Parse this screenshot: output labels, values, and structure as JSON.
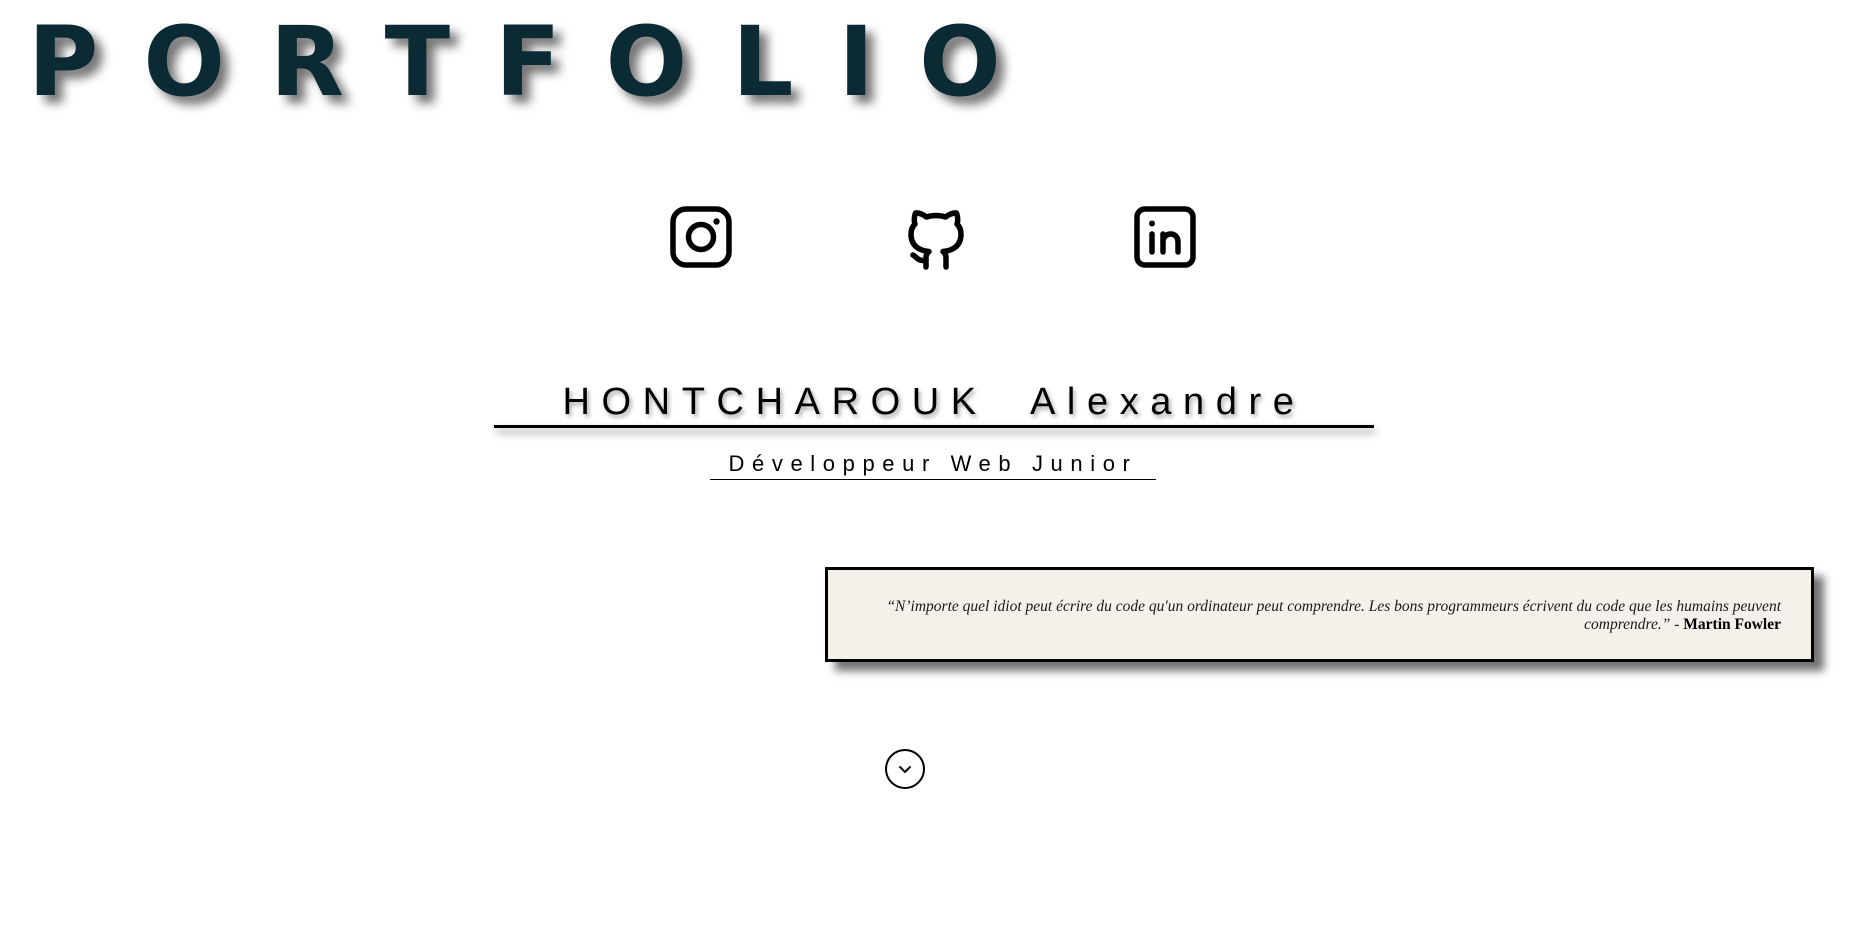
{
  "header": {
    "title": "PORTFOLIO"
  },
  "social": {
    "links": [
      {
        "name": "Instagram",
        "icon": "instagram-icon"
      },
      {
        "name": "GitHub",
        "icon": "github-icon"
      },
      {
        "name": "LinkedIn",
        "icon": "linkedin-icon"
      }
    ]
  },
  "hero": {
    "name": "HONTCHAROUK  Alexandre",
    "role": "Développeur Web Junior"
  },
  "quote": {
    "text": "“N’importe quel idiot peut écrire du code qu'un ordinateur peut comprendre. Les bons programmeurs écrivent du code que les humains peuvent comprendre.”",
    "separator": " - ",
    "author": "Martin Fowler"
  },
  "scroll": {
    "icon": "chevron-down-icon"
  },
  "colors": {
    "title": "#0b2a33",
    "quote_background": "#f4f0ea",
    "text": "#000000"
  }
}
